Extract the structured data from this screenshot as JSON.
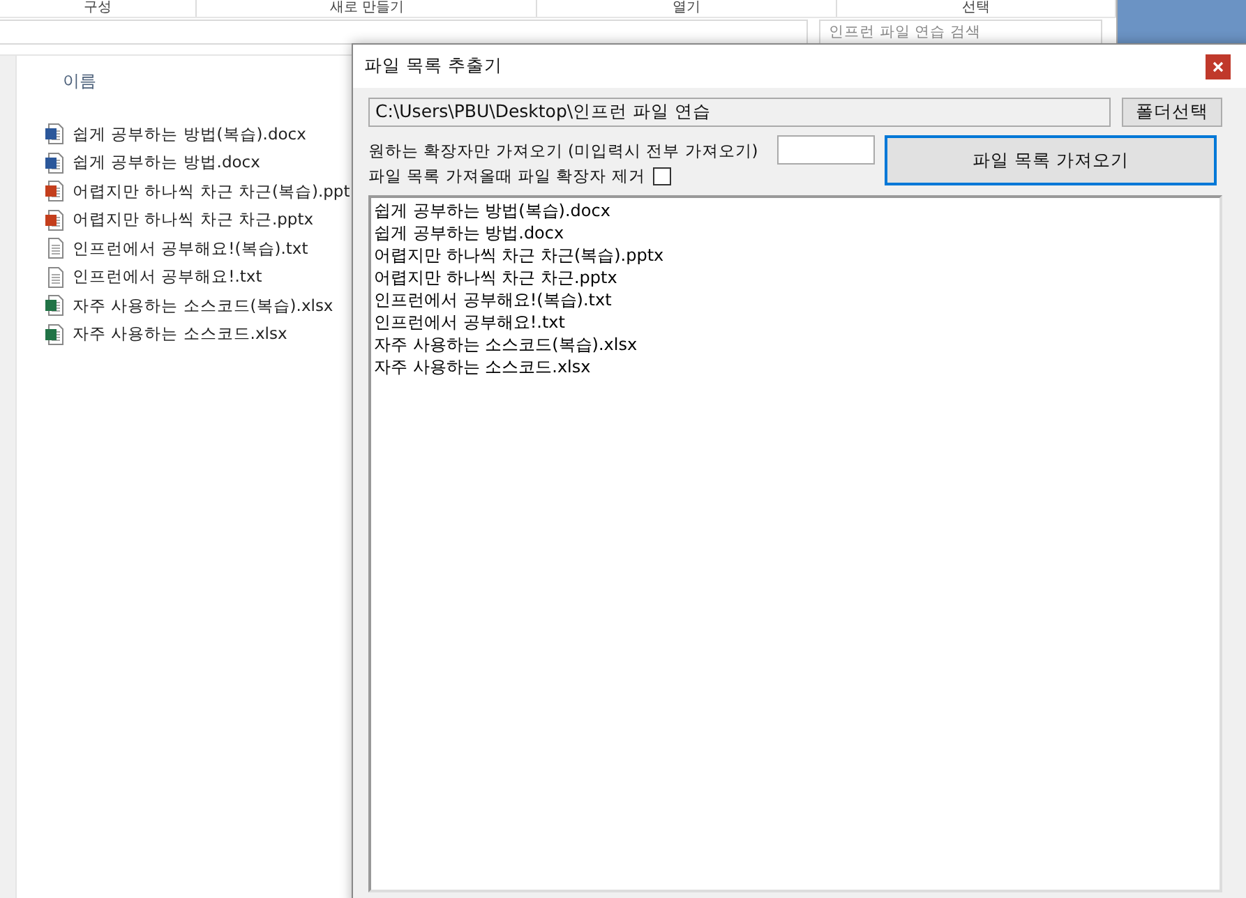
{
  "explorer": {
    "ribbon_groups": [
      "구성",
      "새로 만들기",
      "열기",
      "선택"
    ],
    "search": {
      "placeholder": "인프런 파일 연습 검색"
    },
    "column_header": "이름",
    "files": [
      {
        "name": "쉽게 공부하는 방법(복습).docx",
        "kind": "word"
      },
      {
        "name": "쉽게 공부하는 방법.docx",
        "kind": "word"
      },
      {
        "name": "어렵지만 하나씩 차근 차근(복습).ppt",
        "kind": "powerpoint"
      },
      {
        "name": "어렵지만 하나씩 차근 차근.pptx",
        "kind": "powerpoint"
      },
      {
        "name": "인프런에서 공부해요!(복습).txt",
        "kind": "text"
      },
      {
        "name": "인프런에서 공부해요!.txt",
        "kind": "text"
      },
      {
        "name": "자주 사용하는 소스코드(복습).xlsx",
        "kind": "excel"
      },
      {
        "name": "자주 사용하는 소스코드.xlsx",
        "kind": "excel"
      }
    ]
  },
  "dialog": {
    "title": "파일 목록 추출기",
    "path": "C:\\Users\\PBU\\Desktop\\인프런 파일 연습",
    "folder_button": "폴더선택",
    "extension_label": "원하는 확장자만 가져오기 (미입력시 전부 가져오기)",
    "remove_extension_label": "파일 목록 가져올때 파일 확장자 제거",
    "remove_extension_checked": false,
    "fetch_button": "파일 목록 가져오기",
    "output_lines": [
      "쉽게 공부하는 방법(복습).docx",
      "쉽게 공부하는 방법.docx",
      "어렵지만 하나씩 차근 차근(복습).pptx",
      "어렵지만 하나씩 차근 차근.pptx",
      "인프런에서 공부해요!(복습).txt",
      "인프런에서 공부해요!.txt",
      "자주 사용하는 소스코드(복습).xlsx",
      "자주 사용하는 소스코드.xlsx"
    ]
  }
}
